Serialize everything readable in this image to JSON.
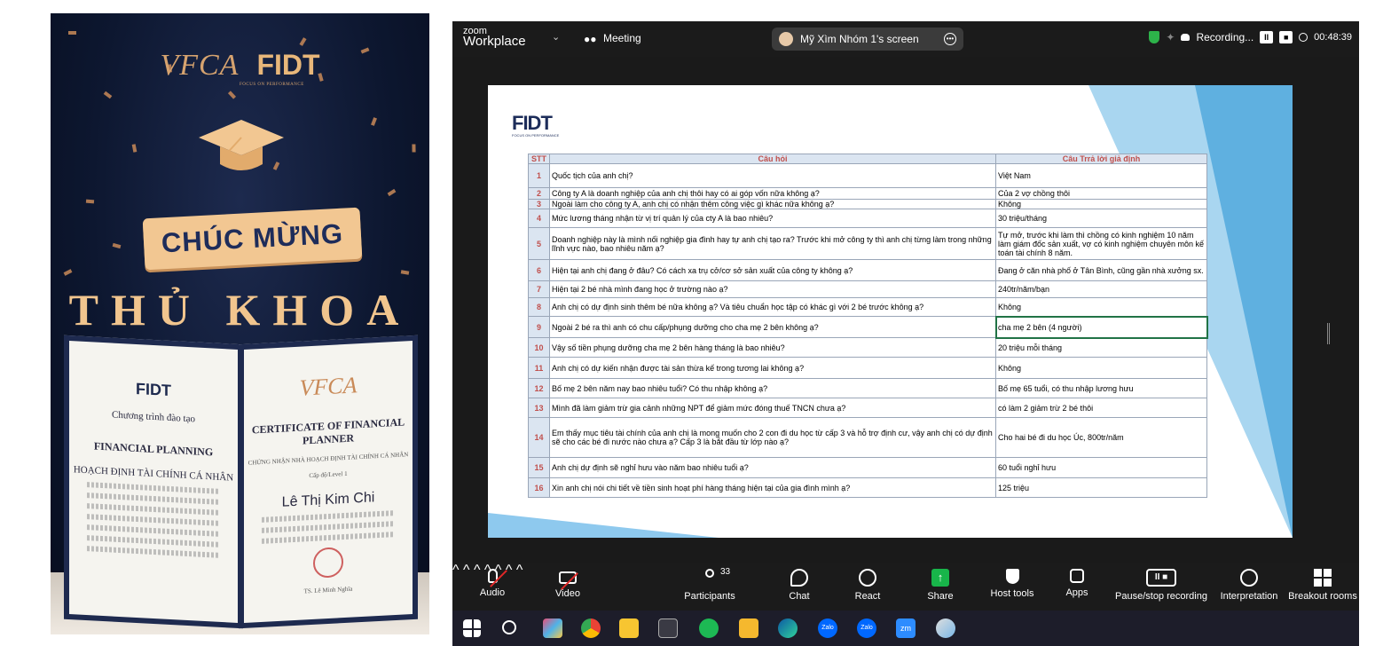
{
  "photo": {
    "brand_left": "VFCA",
    "brand_right": "FIDT",
    "brand_tagline": "FOCUS ON PERFORMANCE",
    "banner_line1": "CHÚC MỪNG",
    "banner_line2": "THỦ KHOA",
    "cert_left": {
      "logo": "FIDT",
      "line1": "Chương trình đào tạo",
      "line2": "FINANCIAL PLANNING",
      "line3": "HOẠCH ĐỊNH TÀI CHÍNH CÁ NHÂN"
    },
    "cert_right": {
      "logo": "VFCA",
      "title": "CERTIFICATE OF FINANCIAL PLANNER",
      "subtitle": "CHỨNG NHẬN NHÀ HOẠCH ĐỊNH TÀI CHÍNH CÁ NHÂN",
      "level": "Cấp độ/Level 1",
      "name": "Lê Thị Kim Chi",
      "signer": "TS. Lê Minh Nghĩa"
    }
  },
  "zoom": {
    "logo_top": "zoom",
    "logo_bottom": "Workplace",
    "meeting_label": "Meeting",
    "share_label": "Mỹ Xìm Nhóm 1's screen",
    "recording_label": "Recording...",
    "timer": "00:48:39",
    "slide": {
      "logo": "FIDT",
      "logo_tag": "FOCUS ON PERFORMANCE",
      "headers": {
        "stt": "STT",
        "question": "Câu hỏi",
        "answer": "Câu Trrả lời giả định"
      },
      "rows": [
        {
          "stt": "1",
          "question": "Quốc tịch của anh chị?",
          "answer": "Việt Nam"
        },
        {
          "stt": "2",
          "question": "Công ty A là doanh nghiệp của anh chị thôi hay có ai góp vốn nữa không ạ?",
          "answer": "Của 2 vợ chồng thôi"
        },
        {
          "stt": "3",
          "question": "Ngoài làm cho công ty A, anh chị có nhận thêm công việc gì khác nữa không ạ?",
          "answer": "Không"
        },
        {
          "stt": "4",
          "question": "Mức lương tháng nhận từ vị trí quản lý của cty A là bao nhiêu?",
          "answer": "30 triệu/tháng"
        },
        {
          "stt": "5",
          "question": "Doanh nghiệp này là mình nối nghiệp gia đình hay tự anh chị tạo ra? Trước khi mở công ty thì anh chị từng làm trong những lĩnh vực nào, bao nhiêu năm ạ?",
          "answer": "Tự mở, trước khi làm thì chồng có kinh nghiệm 10 năm làm giám đốc sản xuất, vợ có kinh nghiệm chuyên môn kế toán tài chính 8 năm."
        },
        {
          "stt": "6",
          "question": "Hiện tại anh chị đang ở đâu? Có cách xa trụ cở/cơ sở sản xuất của công ty không ạ?",
          "answer": "Đang ở căn nhà phố ở Tân Bình, cũng gần nhà xưởng sx."
        },
        {
          "stt": "7",
          "question": "Hiện tại 2 bé nhà mình đang học ở trường nào ạ?",
          "answer": "240tr/năm/bạn"
        },
        {
          "stt": "8",
          "question": "Anh chị có dự định sinh thêm bé nữa không ạ? Và tiêu chuẩn học tập có khác gì với 2 bé trước không ạ?",
          "answer": "Không"
        },
        {
          "stt": "9",
          "question": "Ngoài 2 bé ra thì anh có chu cấp/phụng dưỡng cho cha mẹ 2 bên không ạ?",
          "answer": "cha mẹ 2 bên (4 người)"
        },
        {
          "stt": "10",
          "question": "Vậy số tiền phụng dưỡng cha mẹ 2 bên hàng tháng là bao nhiêu?",
          "answer": "20 triệu mỗi tháng"
        },
        {
          "stt": "11",
          "question": "Anh chị có dự kiến nhận được tài sản thừa kế trong tương lai không ạ?",
          "answer": "Không"
        },
        {
          "stt": "12",
          "question": "Bố mẹ 2 bên năm nay bao nhiêu tuổi? Có thu nhập không ạ?",
          "answer": "Bố mẹ 65 tuổi, có thu nhập lương hưu"
        },
        {
          "stt": "13",
          "question": "Mình đã làm giảm trừ gia cảnh những NPT để giảm mức đóng thuế TNCN chưa ạ?",
          "answer": "có làm 2 giảm trừ 2 bé thôi"
        },
        {
          "stt": "14",
          "question": "Em thấy mục tiêu tài chính của anh chị là mong muốn cho 2 con đi du học từ cấp 3 và hỗ trợ định cư, vậy anh chị có dự định sẽ cho các bé đi nước nào chưa ạ? Cấp 3 là bắt đầu từ lớp nào ạ?",
          "answer": "Cho hai bé đi du học Úc, 800tr/năm"
        },
        {
          "stt": "15",
          "question": "Anh chị dự định sẽ nghỉ hưu vào năm bao nhiêu tuổi ạ?",
          "answer": "60 tuổi nghỉ hưu"
        },
        {
          "stt": "16",
          "question": "Xin anh chị nói chi tiết về tiền sinh hoạt phí hàng tháng hiện tại của gia đình mình ạ?",
          "answer": "125 triệu"
        }
      ]
    },
    "toolbar": {
      "audio": "Audio",
      "video": "Video",
      "participants": "Participants",
      "participants_count": "33",
      "chat": "Chat",
      "react": "React",
      "share": "Share",
      "host_tools": "Host tools",
      "apps": "Apps",
      "pause_recording": "Pause/stop recording",
      "interpretation": "Interpretation",
      "breakout": "Breakout rooms"
    },
    "taskbar": {
      "icons": [
        "windows-start-icon",
        "search-icon",
        "paint-icon",
        "chrome-icon",
        "sticky-notes-icon",
        "calculator-icon",
        "spotify-icon",
        "file-explorer-icon",
        "edge-icon",
        "zalo-icon",
        "zalo-icon",
        "zoom-icon",
        "snipping-tool-icon"
      ],
      "zalo_label": "Zalo",
      "zoom_label": "zm"
    }
  }
}
